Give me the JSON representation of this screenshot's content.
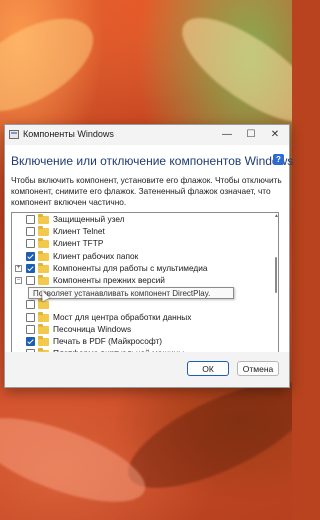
{
  "window": {
    "title": "Компоненты Windows",
    "minimize_glyph": "—",
    "maximize_glyph": "☐",
    "close_glyph": "✕"
  },
  "dialog": {
    "heading": "Включение или отключение компонентов Windows",
    "help_glyph": "?",
    "description": "Чтобы включить компонент, установите его флажок. Чтобы отключить компонент, снимите его флажок. Затененный флажок означает, что компонент включен частично."
  },
  "tree": {
    "items": [
      {
        "label": "Защищенный узел",
        "checked": false,
        "expander": false,
        "indent": 0
      },
      {
        "label": "Клиент Telnet",
        "checked": false,
        "expander": false,
        "indent": 0
      },
      {
        "label": "Клиент TFTP",
        "checked": false,
        "expander": false,
        "indent": 0
      },
      {
        "label": "Клиент рабочих папок",
        "checked": true,
        "expander": false,
        "indent": 0
      },
      {
        "label": "Компоненты для работы с мультимедиа",
        "checked": true,
        "expander": "+",
        "indent": 0
      },
      {
        "label": "Компоненты прежних версий",
        "checked": false,
        "expander": "−",
        "indent": 0
      },
      {
        "label": "DirectPlay",
        "checked": false,
        "expander": false,
        "indent": 1
      },
      {
        "label": "",
        "checked": false,
        "expander": false,
        "indent": 0
      },
      {
        "label": "Мост для центра обработки данных",
        "checked": false,
        "expander": false,
        "indent": 0
      },
      {
        "label": "Песочница Windows",
        "checked": false,
        "expander": false,
        "indent": 0
      },
      {
        "label": "Печать в PDF (Майкрософт)",
        "checked": true,
        "expander": false,
        "indent": 0
      },
      {
        "label": "Платформа виртуальной машины",
        "checked": false,
        "expander": false,
        "indent": 0
      }
    ]
  },
  "tooltip": {
    "text": "Позволяет устанавливать компонент DirectPlay."
  },
  "footer": {
    "ok_label": "ОК",
    "cancel_label": "Отмена"
  },
  "colors": {
    "accent": "#1a5fb4",
    "heading": "#1f3c72",
    "folder": "#f2c94c"
  }
}
